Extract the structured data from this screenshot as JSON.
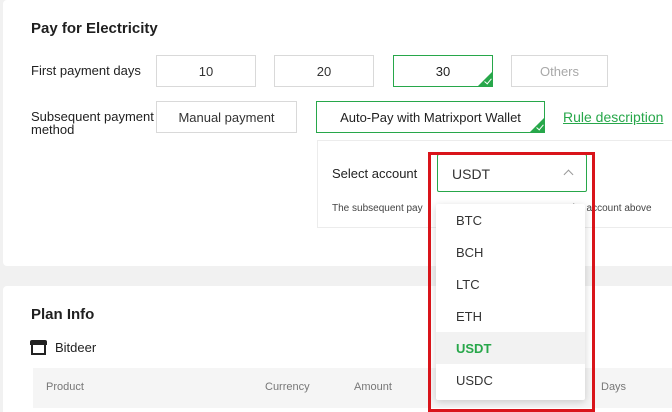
{
  "electricity": {
    "title": "Pay for Electricity",
    "first_days_label": "First payment days",
    "day_options": [
      "10",
      "20",
      "30",
      "Others"
    ],
    "subsequent_label_line1": "Subsequent payment",
    "subsequent_label_line2": "method",
    "manual_label": "Manual payment",
    "autopay_label": "Auto-Pay with Matrixport Wallet",
    "rule_link": "Rule description",
    "select_account_label": "Select account",
    "selected_account": "USDT",
    "note_left": "The subsequent pay",
    "note_right": "he account above",
    "account_options": [
      "BTC",
      "BCH",
      "LTC",
      "ETH",
      "USDT",
      "USDC"
    ]
  },
  "plan": {
    "title": "Plan Info",
    "brand": "Bitdeer",
    "columns": [
      "Product",
      "Currency",
      "Amount",
      "Days"
    ]
  },
  "colors": {
    "accent": "#27a74a",
    "highlight": "#d9141a"
  }
}
